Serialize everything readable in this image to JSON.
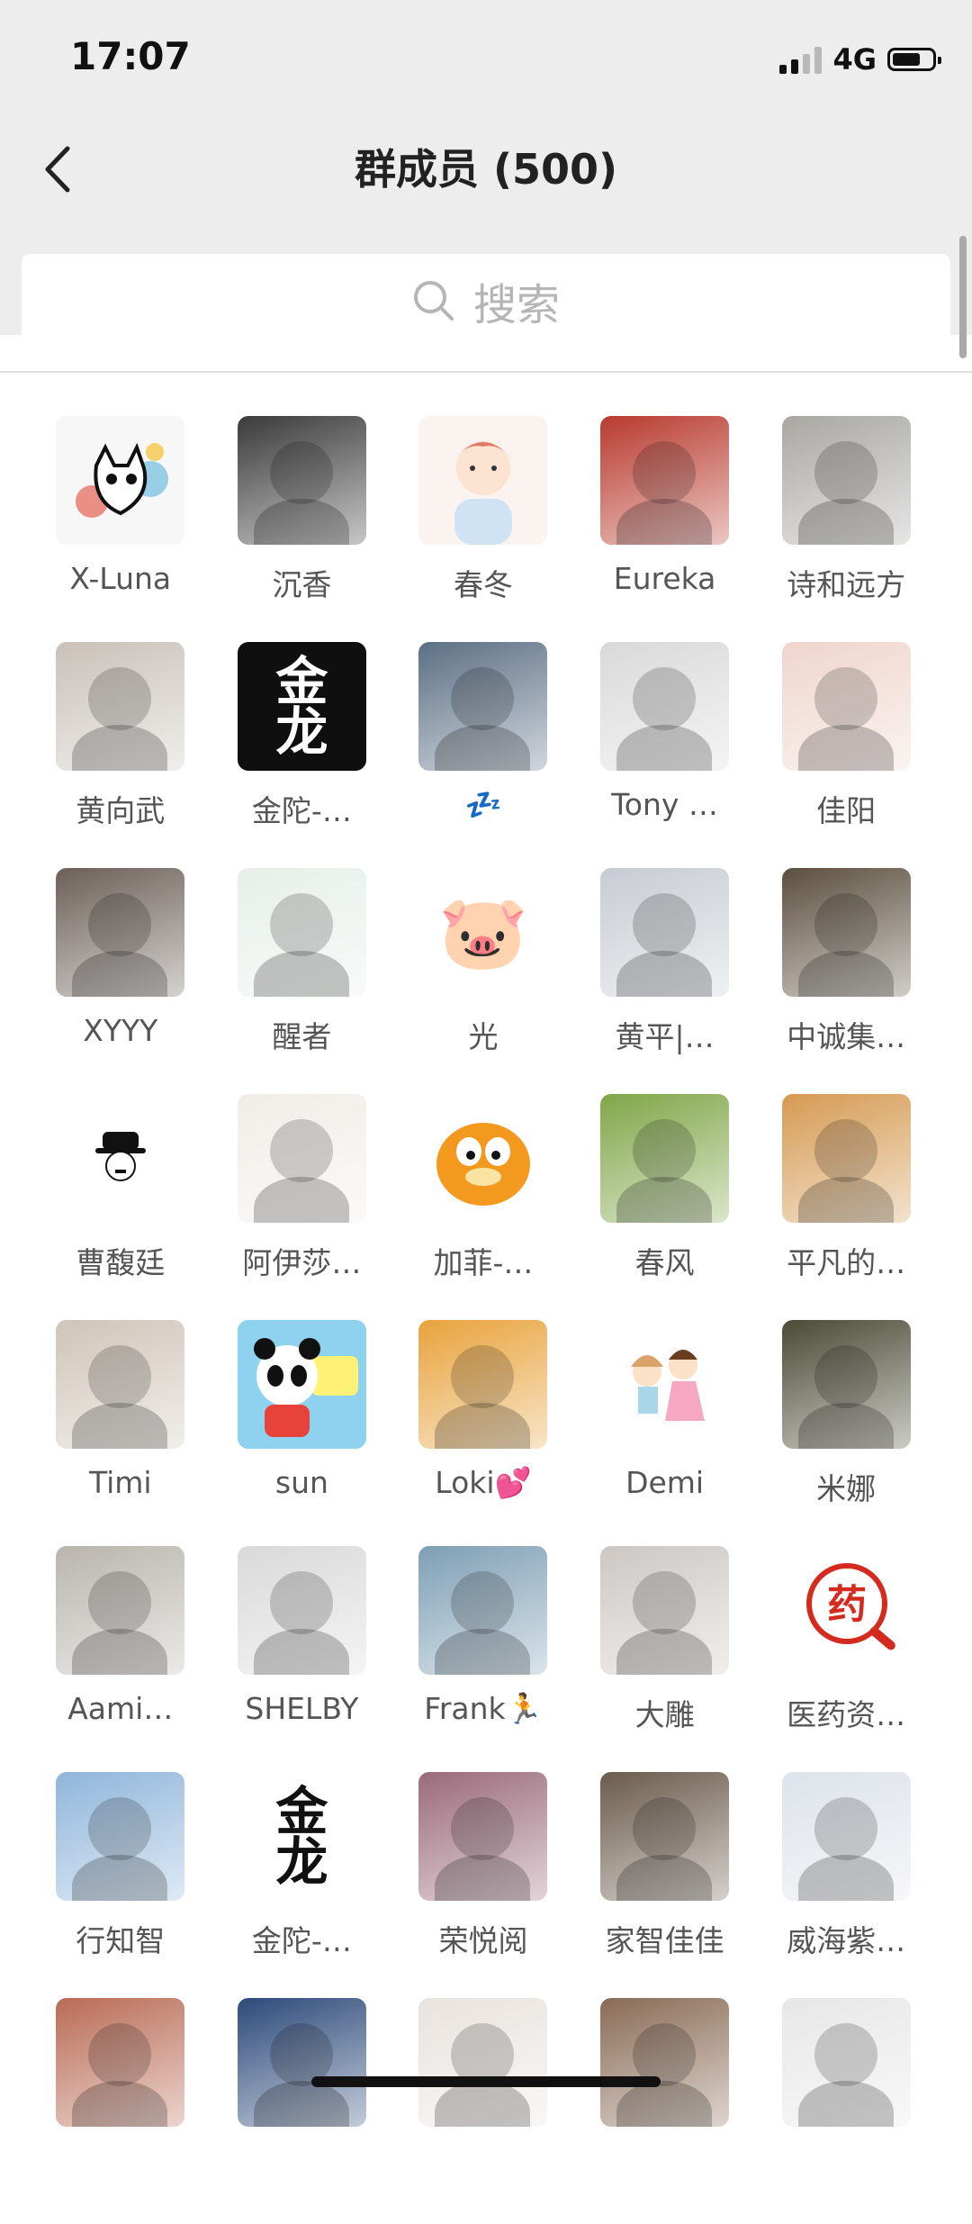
{
  "status": {
    "time": "17:07",
    "network": "4G"
  },
  "header": {
    "title": "群成员 (500)"
  },
  "search": {
    "placeholder": "搜索"
  },
  "members": [
    {
      "name": "X-Luna",
      "avatar": "cat-art",
      "bg": "#f2f2f2"
    },
    {
      "name": "沉香",
      "avatar": "photo-person",
      "bg": "#3a3a3a"
    },
    {
      "name": "春冬",
      "avatar": "cartoon-boy",
      "bg": "#fbf3ef"
    },
    {
      "name": "Eureka",
      "avatar": "photo-car",
      "bg": "#b83a2e"
    },
    {
      "name": "诗和远方",
      "avatar": "photo-sunset-person",
      "bg": "#a9a7a2"
    },
    {
      "name": "黄向武",
      "avatar": "photo-man",
      "bg": "#c9c1b9"
    },
    {
      "name": "金陀-…",
      "avatar": "logo-jinlong-dark",
      "bg": "#0f0f0f"
    },
    {
      "name": "💤",
      "avatar": "photo-trees",
      "bg": "#5c6f84"
    },
    {
      "name": "Tony …",
      "avatar": "photo-building",
      "bg": "#d9d9d9"
    },
    {
      "name": "佳阳",
      "avatar": "photo-woman",
      "bg": "#efd5cc"
    },
    {
      "name": "XYYY",
      "avatar": "photo-woman-flower",
      "bg": "#6c6058"
    },
    {
      "name": "醒者",
      "avatar": "logo-circle",
      "bg": "#e7efea"
    },
    {
      "name": "光",
      "avatar": "pig-emoji",
      "bg": "#ffffff"
    },
    {
      "name": "黄平|…",
      "avatar": "photo-conference",
      "bg": "#c8cbd3"
    },
    {
      "name": "中诚集…",
      "avatar": "photo-woman-dark",
      "bg": "#5b4f3e"
    },
    {
      "name": "曹馥廷",
      "avatar": "chaplin",
      "bg": "#ffffff"
    },
    {
      "name": "阿伊莎…",
      "avatar": "photo-woman-white",
      "bg": "#f1ece7"
    },
    {
      "name": "加菲-…",
      "avatar": "garfield",
      "bg": "#ffffff"
    },
    {
      "name": "春风",
      "avatar": "photo-landscape",
      "bg": "#7fa648"
    },
    {
      "name": "平凡的…",
      "avatar": "illustration-girl",
      "bg": "#d59a52"
    },
    {
      "name": "Timi",
      "avatar": "photo-record",
      "bg": "#cfc4b8"
    },
    {
      "name": "sun",
      "avatar": "cartoon-panda",
      "bg": "#8fd2ef"
    },
    {
      "name": "Loki💕",
      "avatar": "photo-sunset-couple",
      "bg": "#e8a33c"
    },
    {
      "name": "Demi",
      "avatar": "cartoon-kids",
      "bg": "#ffffff"
    },
    {
      "name": "米娜",
      "avatar": "photo-dark-art",
      "bg": "#4b4a35"
    },
    {
      "name": "Aami…",
      "avatar": "photo-silhouette",
      "bg": "#b9b4ad"
    },
    {
      "name": "SHELBY",
      "avatar": "photo-skater",
      "bg": "#d9d9d9"
    },
    {
      "name": "Frank🏃",
      "avatar": "photo-lake",
      "bg": "#7e9fb5"
    },
    {
      "name": "大雕",
      "avatar": "photo-dog",
      "bg": "#ccc7c3"
    },
    {
      "name": "医药资…",
      "avatar": "logo-medicine",
      "bg": "#ffffff"
    },
    {
      "name": "行知智",
      "avatar": "photo-beach",
      "bg": "#8fb5da"
    },
    {
      "name": "金陀-…",
      "avatar": "logo-jinlong-light",
      "bg": "#ffffff"
    },
    {
      "name": "荣悦阅",
      "avatar": "photo-phone-wallpaper",
      "bg": "#9a6a7a"
    },
    {
      "name": "家智佳佳",
      "avatar": "photo-interior",
      "bg": "#6b5b4b"
    },
    {
      "name": "威海紫…",
      "avatar": "photo-man-shirt",
      "bg": "#dde3ea"
    },
    {
      "name": "",
      "avatar": "photo-man-suit",
      "bg": "#b96b55"
    },
    {
      "name": "",
      "avatar": "art-wave",
      "bg": "#2d4a7a"
    },
    {
      "name": "",
      "avatar": "photo-young-man",
      "bg": "#e9e3de"
    },
    {
      "name": "",
      "avatar": "photo-man-wine",
      "bg": "#8a6b55"
    },
    {
      "name": "",
      "avatar": "photo-woman-black",
      "bg": "#e7e7e7"
    }
  ],
  "colors": {
    "header_bg": "#ededed",
    "name_text": "#555555",
    "title_text": "#222222"
  }
}
